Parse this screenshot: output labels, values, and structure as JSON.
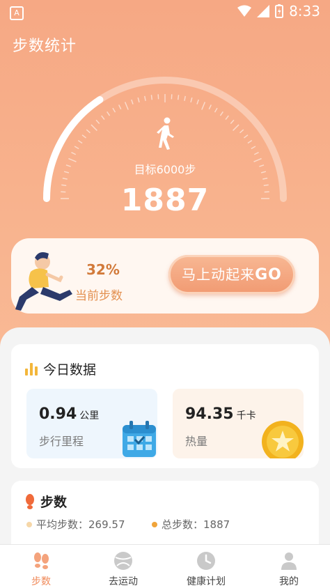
{
  "status_bar": {
    "app_badge": "A",
    "time": "8:33"
  },
  "header": {
    "title": "步数统计"
  },
  "dial": {
    "goal_label": "目标6000步",
    "current_steps": "1887",
    "progress_fraction": 0.3145
  },
  "progress_card": {
    "percent": "32%",
    "percent_label": "当前步数",
    "go_button_label": "马上动起来",
    "go_button_bold": "GO"
  },
  "today": {
    "title": "今日数据",
    "distance": {
      "value": "0.94",
      "unit": "公里",
      "label": "步行里程"
    },
    "calories": {
      "value": "94.35",
      "unit": "千卡",
      "label": "热量"
    }
  },
  "steps_section": {
    "title": "步数",
    "avg_label": "平均步数：269.57",
    "total_label": "总步数：1887"
  },
  "tabs": [
    {
      "label": "步数"
    },
    {
      "label": "去运动"
    },
    {
      "label": "健康计划"
    },
    {
      "label": "我的"
    }
  ],
  "colors": {
    "header_bg": "#f6a884",
    "accent": "#f08a5a",
    "avg_dot": "#f6d7a8",
    "total_dot": "#f0a43a"
  }
}
